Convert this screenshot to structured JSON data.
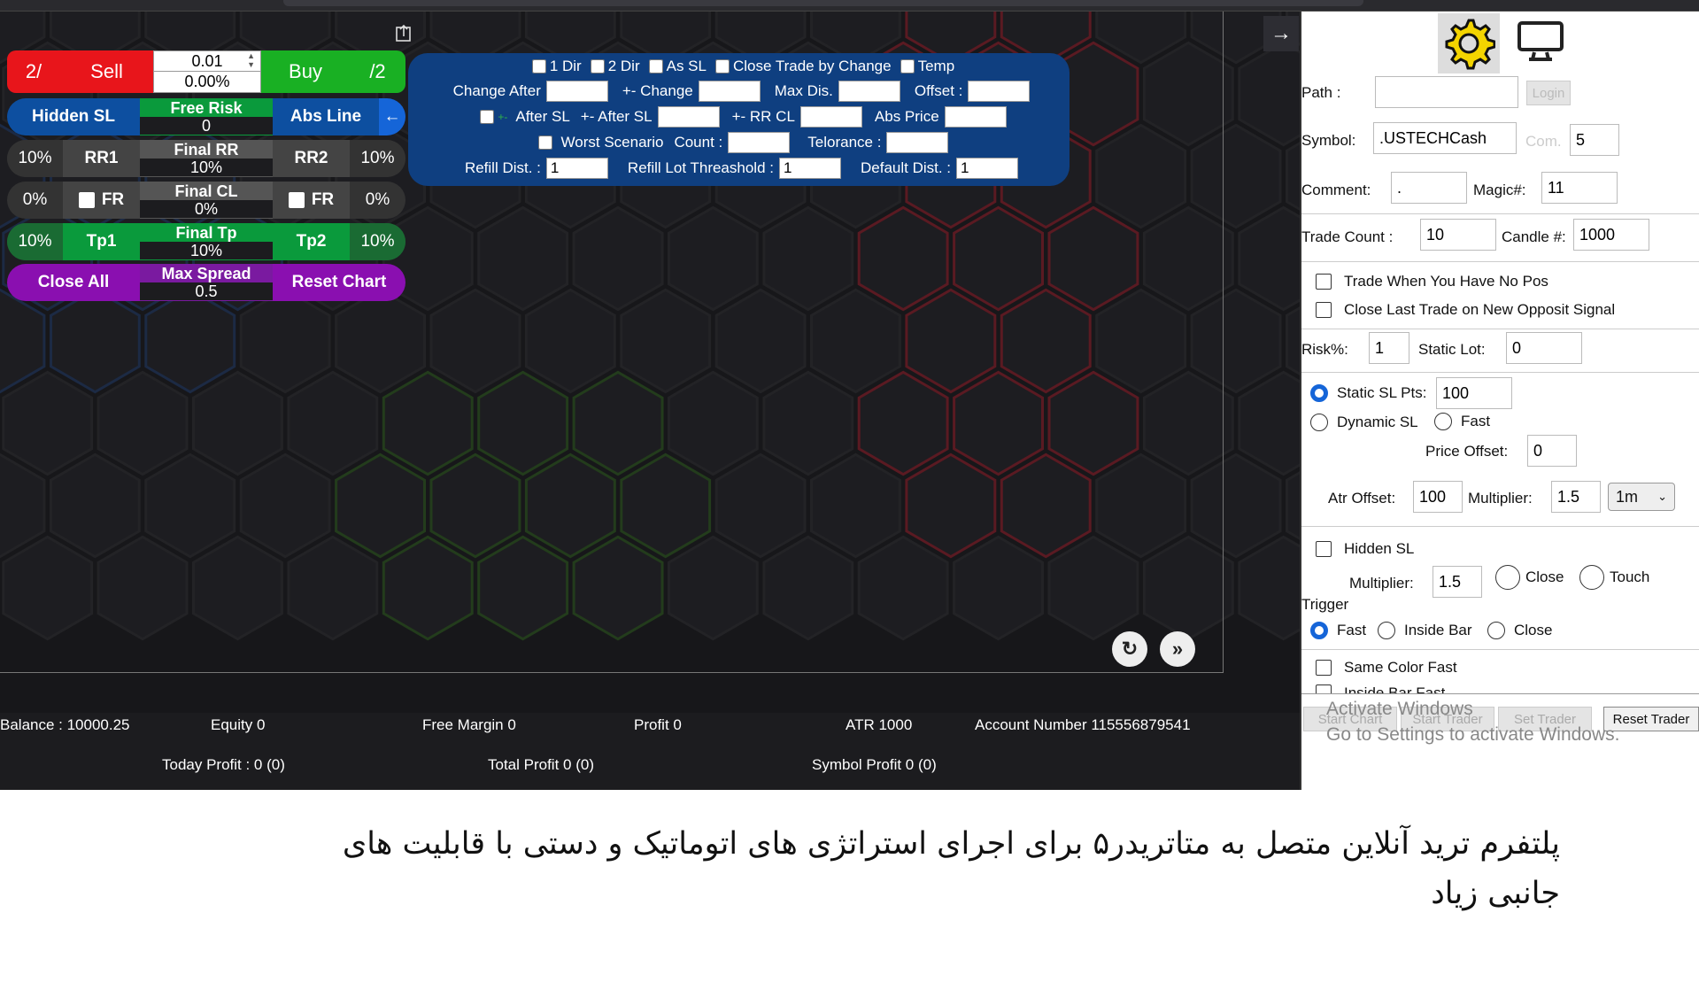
{
  "left_panel": {
    "row1": {
      "half_left": "2/",
      "sell": "Sell",
      "lot": "0.01",
      "risk_pct": "0.00%",
      "buy": "Buy",
      "half_right": "/2"
    },
    "row2": {
      "hidden_sl": "Hidden SL",
      "free_risk_label": "Free Risk",
      "free_risk_value": "0",
      "abs_line": "Abs Line",
      "arrow": "←"
    },
    "row3": {
      "left_pct": "10%",
      "rr1": "RR1",
      "final_rr_label": "Final RR",
      "final_rr_value": "10%",
      "rr2": "RR2",
      "right_pct": "10%"
    },
    "row4": {
      "left_pct": "0%",
      "fr_left": "FR",
      "final_cl_label": "Final CL",
      "final_cl_value": "0%",
      "fr_right": "FR",
      "right_pct": "0%"
    },
    "row5": {
      "left_pct": "10%",
      "tp1": "Tp1",
      "final_tp_label": "Final Tp",
      "final_tp_value": "10%",
      "tp2": "Tp2",
      "right_pct": "10%"
    },
    "row6": {
      "close_all": "Close All",
      "max_spread_label": "Max Spread",
      "max_spread_value": "0.5",
      "reset_chart": "Reset Chart"
    }
  },
  "options_panel": {
    "row1": [
      "1 Dir",
      "2 Dir",
      "As SL",
      "Close Trade by Change",
      "Temp"
    ],
    "change_after": "Change After",
    "pm_change": "+- Change",
    "max_dis": "Max Dis.",
    "offset": "Offset :",
    "pm_small": "+-",
    "after_sl": "After SL",
    "pm_after_sl": "+- After SL",
    "pm_rr_cl": "+- RR CL",
    "abs_price": "Abs Price",
    "worst_scenario": "Worst Scenario",
    "count": "Count :",
    "telorance": "Telorance :",
    "refill_dist": "Refill Dist. :",
    "refill_dist_value": "1",
    "refill_lot": "Refill Lot Threashold :",
    "refill_lot_value": "1",
    "default_dist": "Default Dist. :",
    "default_dist_value": "1"
  },
  "right_panel": {
    "path_label": "Path  :",
    "login": "Login",
    "symbol_label": "Symbol:",
    "symbol_value": ".USTECHCash",
    "com_placeholder": "Com.",
    "com_value": "5",
    "comment_label": "Comment:",
    "comment_value": ".",
    "magic_label": "Magic#:",
    "magic_value": "11",
    "trade_count_label": "Trade Count   :",
    "trade_count_value": "10",
    "candle_label": "Candle #:",
    "candle_value": "1000",
    "trade_no_pos": "Trade When You Have No Pos",
    "close_last": "Close Last Trade on New Opposit Signal",
    "risk_label": "Risk%:",
    "risk_value": "1",
    "static_lot_label": "Static Lot:",
    "static_lot_value": "0",
    "static_sl_label": "Static SL Pts:",
    "static_sl_value": "100",
    "dynamic_sl": "Dynamic SL",
    "fast": "Fast",
    "price_offset_label": "Price Offset:",
    "price_offset_value": "0",
    "atr_offset_label": "Atr Offset:",
    "atr_offset_value": "100",
    "multiplier_label": "Multiplier:",
    "multiplier_value": "1.5",
    "timeframe": "1m",
    "hidden_sl": "Hidden SL",
    "hidden_multiplier_label": "Multiplier:",
    "hidden_multiplier_value": "1.5",
    "close": "Close",
    "touch": "Touch",
    "trigger": "Trigger",
    "trigger_fast": "Fast",
    "inside_bar": "Inside Bar",
    "trigger_close": "Close",
    "same_color_fast": "Same Color Fast",
    "inside_bar_fast": "Inside Bar Fast",
    "start_chart": "Start Chart",
    "start_trader": "Start Trader",
    "set_trader": "Set Trader",
    "reset_trader": "Reset Trader",
    "toggle_arrow": "→"
  },
  "footer": {
    "balance": "Balance : 10000.25",
    "equity": "Equity 0",
    "free_margin": "Free Margin 0",
    "profit": "Profit 0",
    "atr": "ATR 1000",
    "account": "Account Number 115556879541",
    "today_profit": "Today Profit : 0 (0)",
    "total_profit": "Total Profit 0 (0)",
    "symbol_profit": "Symbol Profit 0 (0)"
  },
  "watermark": {
    "line1": "Activate Windows",
    "line2": "Go to Settings to activate Windows."
  },
  "caption": {
    "line1": "پلتفرم ترید آنلاین متصل به متاتریدر۵ برای اجرای استراتژی های اتوماتیک و دستی با قابلیت های",
    "line2": "جانبی زیاد"
  },
  "colors": {
    "sell": "#e8151b",
    "buy": "#19b023",
    "blue": "#0d4fa0",
    "green": "#0a9a3c",
    "purple": "#8a0fb0",
    "panel": "#0f3f80",
    "gear": "#f3d400"
  }
}
